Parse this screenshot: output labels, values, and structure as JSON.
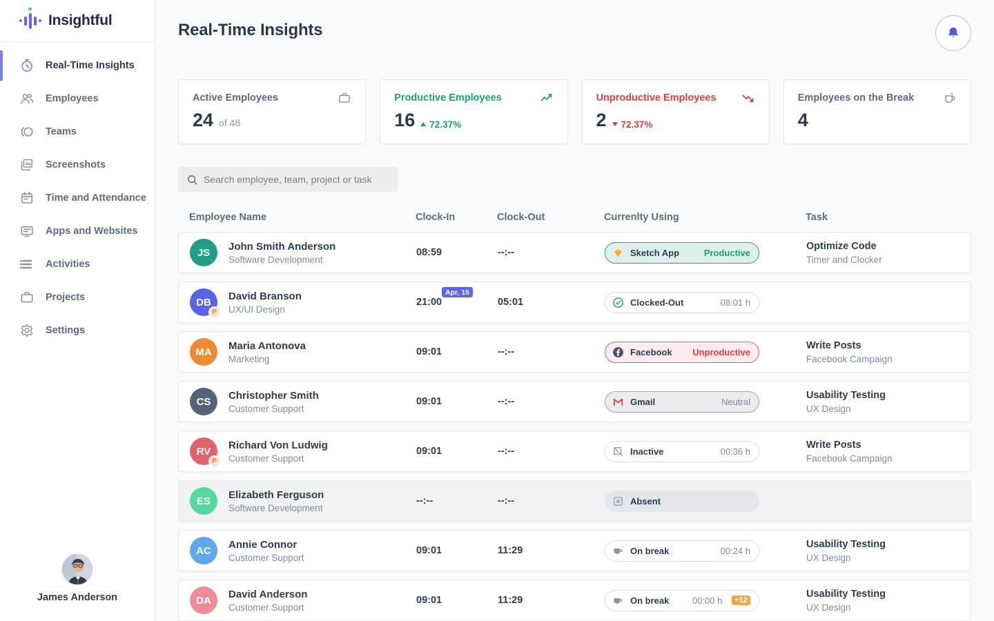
{
  "brand": {
    "name": "Insightful"
  },
  "sidebar": {
    "items": [
      {
        "label": "Real-Time Insights",
        "icon": "timer-icon",
        "active": true
      },
      {
        "label": "Employees",
        "icon": "people-icon",
        "active": false
      },
      {
        "label": "Teams",
        "icon": "teams-icon",
        "active": false
      },
      {
        "label": "Screenshots",
        "icon": "screenshots-icon",
        "active": false
      },
      {
        "label": "Time and Attendance",
        "icon": "calendar-icon",
        "active": false
      },
      {
        "label": "Apps and Websites",
        "icon": "apps-icon",
        "active": false
      },
      {
        "label": "Activities",
        "icon": "activities-icon",
        "active": false
      },
      {
        "label": "Projects",
        "icon": "briefcase-icon",
        "active": false
      },
      {
        "label": "Settings",
        "icon": "gear-icon",
        "active": false
      }
    ],
    "profile": {
      "name": "James Anderson"
    }
  },
  "header": {
    "title": "Real-Time Insights"
  },
  "stats": [
    {
      "label": "Active Employees",
      "value": "24",
      "suffix": "of 48",
      "icon": "briefcase-icon"
    },
    {
      "label": "Productive Employees",
      "value": "16",
      "delta": "72.37%",
      "direction": "up",
      "icon": "trend-up-icon"
    },
    {
      "label": "Unproductive Employees",
      "value": "2",
      "delta": "72.37%",
      "direction": "down",
      "icon": "trend-down-icon"
    },
    {
      "label": "Employees on the Break",
      "value": "4",
      "icon": "coffee-cup-icon"
    }
  ],
  "search": {
    "placeholder": "Search employee, team, project or task"
  },
  "colors": {
    "accent": "#5b67e3",
    "productive": "#1b9e7e",
    "unproductive": "#e03e3e",
    "warning": "#f6a545"
  },
  "table": {
    "columns": [
      "Employee Name",
      "Clock-In",
      "Clock-Out",
      "Currenlty Using",
      "Task"
    ],
    "rows": [
      {
        "initials": "JS",
        "avatar_color": "#1f9e89",
        "p_badge": false,
        "name": "John Smith Anderson",
        "team": "Software Development",
        "clock_in": "08:59",
        "clock_in_badge": "",
        "clock_out": "--:--",
        "muted": false,
        "chip": {
          "type": "productive",
          "icon": "sketch-icon",
          "label": "Sketch App",
          "right": "Productive",
          "extra": ""
        },
        "task_title": "Optimize Code",
        "task_subtitle": "Timer and Clocker"
      },
      {
        "initials": "DB",
        "avatar_color": "#5a62e8",
        "p_badge": true,
        "name": "David Branson",
        "team": "UX/UI Design",
        "clock_in": "21:00",
        "clock_in_badge": "Apr, 15",
        "clock_out": "05:01",
        "muted": false,
        "chip": {
          "type": "plain",
          "icon": "check-circle-icon",
          "label": "Clocked-Out",
          "right": "08:01 h",
          "extra": ""
        },
        "task_title": "",
        "task_subtitle": ""
      },
      {
        "initials": "MA",
        "avatar_color": "#ee8b32",
        "p_badge": false,
        "name": "Maria Antonova",
        "team": "Marketing",
        "clock_in": "09:01",
        "clock_in_badge": "",
        "clock_out": "--:--",
        "muted": false,
        "chip": {
          "type": "unproductive",
          "icon": "facebook-icon",
          "label": "Facebook",
          "right": "Unproductive",
          "extra": ""
        },
        "task_title": "Write Posts",
        "task_subtitle": "Facebook Campaign"
      },
      {
        "initials": "CS",
        "avatar_color": "#546378",
        "p_badge": false,
        "name": "Christopher Smith",
        "team": "Customer Support",
        "clock_in": "09:01",
        "clock_in_badge": "",
        "clock_out": "--:--",
        "muted": false,
        "chip": {
          "type": "neutral",
          "icon": "gmail-icon",
          "label": "Gmail",
          "right": "Neutral",
          "extra": ""
        },
        "task_title": "Usability Testing",
        "task_subtitle": "UX Design"
      },
      {
        "initials": "RV",
        "avatar_color": "#e0636a",
        "p_badge": true,
        "name": "Richard Von Ludwig",
        "team": "Customer Support",
        "clock_in": "09:01",
        "clock_in_badge": "",
        "clock_out": "--:--",
        "muted": false,
        "chip": {
          "type": "plain",
          "icon": "inactive-icon",
          "label": "Inactive",
          "right": "00:36 h",
          "extra": ""
        },
        "task_title": "Write Posts",
        "task_subtitle": "Facebook Campaign"
      },
      {
        "initials": "ES",
        "avatar_color": "#52d9a0",
        "p_badge": false,
        "name": "Elizabeth Ferguson",
        "team": "Software Development",
        "clock_in": "--:--",
        "clock_in_badge": "",
        "clock_out": "--:--",
        "muted": true,
        "chip": {
          "type": "absent",
          "icon": "absent-icon",
          "label": "Absent",
          "right": "",
          "extra": ""
        },
        "task_title": "",
        "task_subtitle": ""
      },
      {
        "initials": "AC",
        "avatar_color": "#5fa8ee",
        "p_badge": false,
        "name": "Annie Connor",
        "team": "Customer Support",
        "clock_in": "09:01",
        "clock_in_badge": "",
        "clock_out": "11:29",
        "muted": false,
        "chip": {
          "type": "plain",
          "icon": "coffee-mug-icon",
          "label": "On break",
          "right": "00:24 h",
          "extra": ""
        },
        "task_title": "Usability Testing",
        "task_subtitle": "UX Design"
      },
      {
        "initials": "DA",
        "avatar_color": "#ef8d96",
        "p_badge": false,
        "name": "David Anderson",
        "team": "Customer Support",
        "clock_in": "09:01",
        "clock_in_badge": "",
        "clock_out": "11:29",
        "muted": false,
        "chip": {
          "type": "plain",
          "icon": "coffee-mug-icon",
          "label": "On break",
          "right": "00:00 h",
          "extra": "+12"
        },
        "task_title": "Usability Testing",
        "task_subtitle": "UX Design"
      }
    ]
  }
}
